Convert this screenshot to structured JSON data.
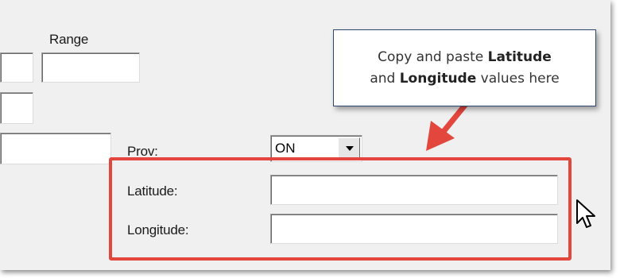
{
  "form": {
    "range_label": "Range",
    "prov_label": "Prov:",
    "prov_value": "ON",
    "latitude_label": "Latitude:",
    "latitude_value": "",
    "longitude_label": "Longitude:",
    "longitude_value": ""
  },
  "callout": {
    "line1_prefix": "Copy and paste ",
    "line1_bold": "Latitude",
    "line2_prefix": "and ",
    "line2_bold": "Longitude",
    "line2_suffix": " values here"
  },
  "colors": {
    "highlight": "#e2463d",
    "callout_border": "#2d4a6e",
    "window_bg": "#f0f0f0"
  },
  "icons": {
    "dropdown": "chevron-down-icon",
    "arrow": "red-arrow-icon",
    "cursor": "mouse-pointer-icon"
  }
}
